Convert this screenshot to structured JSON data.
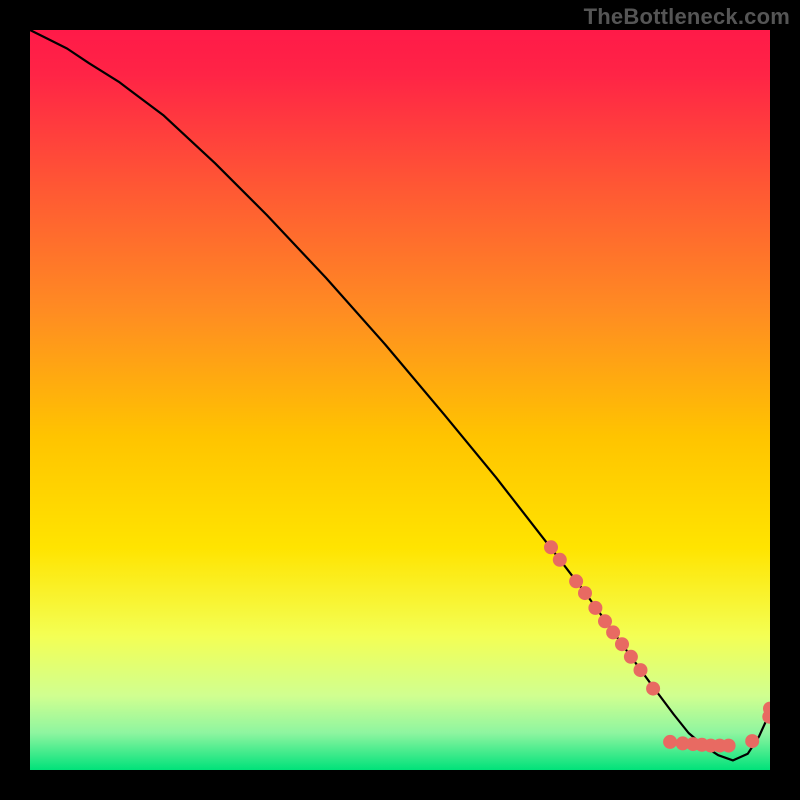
{
  "watermark": "TheBottleneck.com",
  "chart_data": {
    "type": "line",
    "title": "",
    "xlabel": "",
    "ylabel": "",
    "xlim": [
      0,
      100
    ],
    "ylim": [
      0,
      100
    ],
    "grid": false,
    "legend": false,
    "background_gradient": {
      "top": "#ff1a48",
      "upper_mid": "#ff8a2a",
      "mid": "#ffe400",
      "lower": "#d6ff8a",
      "bottom": "#00e27a"
    },
    "series": [
      {
        "name": "bottleneck-curve",
        "color": "#000000",
        "x": [
          0,
          2,
          5,
          8,
          12,
          18,
          25,
          32,
          40,
          48,
          56,
          63,
          70,
          75,
          80,
          84,
          87,
          89,
          91,
          93,
          95,
          97,
          98.5,
          100
        ],
        "y": [
          100,
          99,
          97.5,
          95.5,
          93,
          88.5,
          82,
          75,
          66.5,
          57.5,
          48,
          39.5,
          30.5,
          24,
          17,
          11.5,
          7.5,
          5,
          3.3,
          2,
          1.3,
          2.2,
          4.5,
          7.8
        ]
      }
    ],
    "scatter": [
      {
        "name": "gpu-points",
        "color": "#e86a62",
        "radius": 7,
        "points": [
          {
            "x": 70.4,
            "y": 30.1
          },
          {
            "x": 71.6,
            "y": 28.4
          },
          {
            "x": 73.8,
            "y": 25.5
          },
          {
            "x": 75.0,
            "y": 23.9
          },
          {
            "x": 76.4,
            "y": 21.9
          },
          {
            "x": 77.7,
            "y": 20.1
          },
          {
            "x": 78.8,
            "y": 18.6
          },
          {
            "x": 80.0,
            "y": 17.0
          },
          {
            "x": 81.2,
            "y": 15.3
          },
          {
            "x": 82.5,
            "y": 13.5
          },
          {
            "x": 84.2,
            "y": 11.0
          },
          {
            "x": 86.5,
            "y": 3.8
          },
          {
            "x": 88.2,
            "y": 3.6
          },
          {
            "x": 89.6,
            "y": 3.5
          },
          {
            "x": 90.8,
            "y": 3.4
          },
          {
            "x": 92.0,
            "y": 3.3
          },
          {
            "x": 93.2,
            "y": 3.3
          },
          {
            "x": 94.4,
            "y": 3.3
          },
          {
            "x": 97.6,
            "y": 3.9
          },
          {
            "x": 99.9,
            "y": 7.2
          },
          {
            "x": 100.0,
            "y": 8.3
          }
        ]
      }
    ]
  }
}
